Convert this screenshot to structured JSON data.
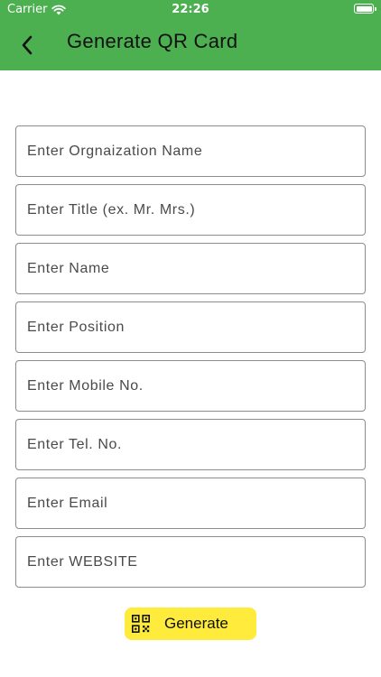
{
  "status_bar": {
    "carrier": "Carrier",
    "time": "22:26"
  },
  "header": {
    "title": "Generate QR Card"
  },
  "form": {
    "fields": [
      {
        "placeholder": "Enter Orgnaization Name",
        "value": ""
      },
      {
        "placeholder": "Enter Title (ex. Mr. Mrs.)",
        "value": ""
      },
      {
        "placeholder": "Enter Name",
        "value": ""
      },
      {
        "placeholder": "Enter Position",
        "value": ""
      },
      {
        "placeholder": "Enter Mobile No.",
        "value": ""
      },
      {
        "placeholder": "Enter Tel. No.",
        "value": ""
      },
      {
        "placeholder": "Enter Email",
        "value": ""
      },
      {
        "placeholder": "Enter WEBSITE",
        "value": ""
      }
    ]
  },
  "actions": {
    "generate_label": "Generate"
  },
  "colors": {
    "app_bar": "#4caf50",
    "button": "#ffeb3b",
    "field_border": "#8c8c8c"
  },
  "icons": {
    "back": "arrow-back-icon",
    "generate": "qr-code-icon",
    "wifi": "wifi-icon",
    "battery": "battery-icon"
  }
}
